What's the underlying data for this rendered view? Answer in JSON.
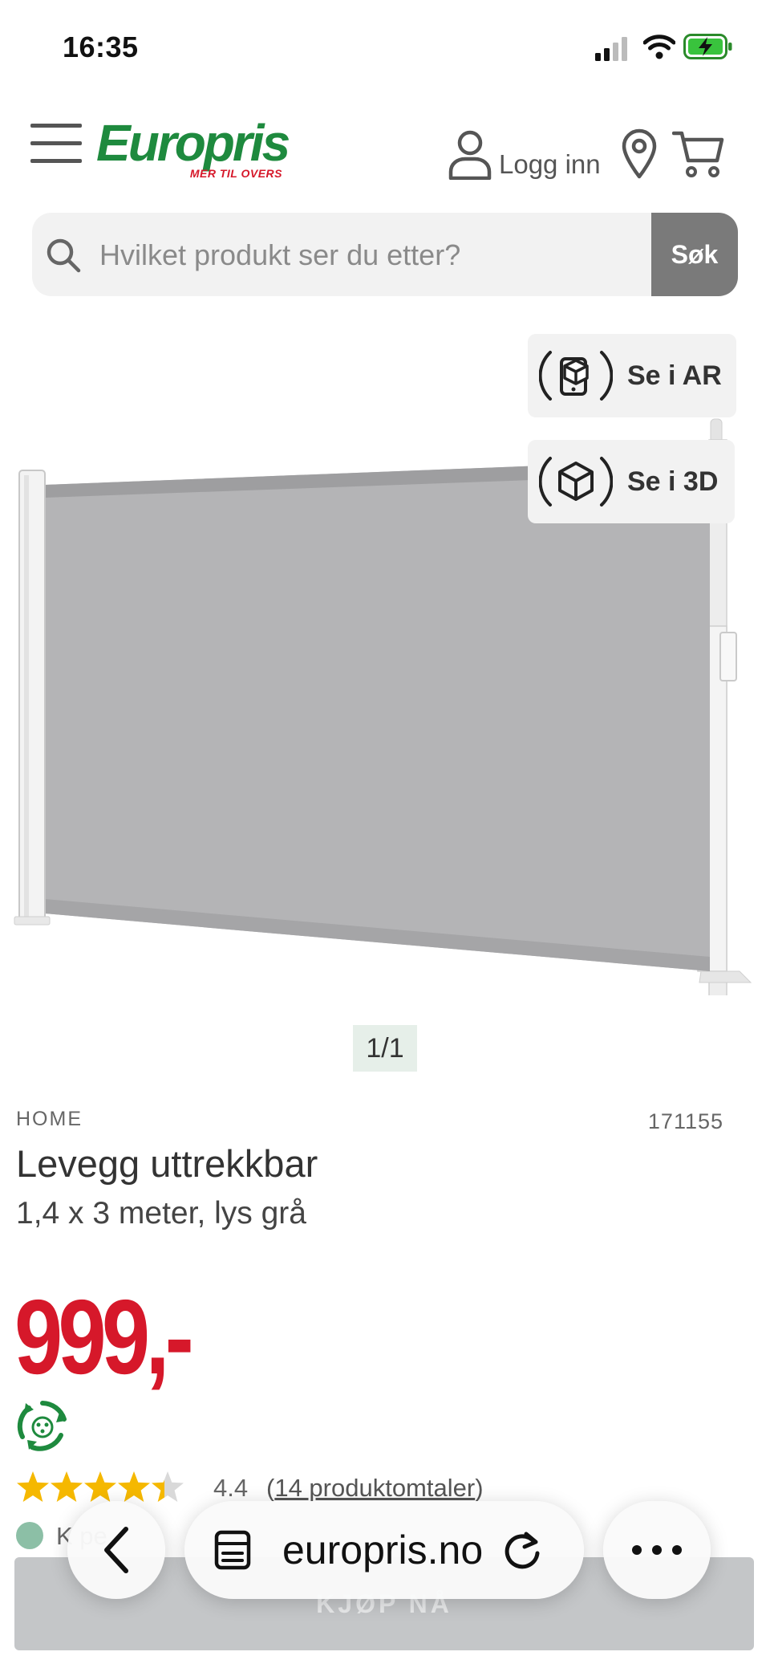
{
  "status_bar": {
    "time": "16:35"
  },
  "header": {
    "logo_text": "Europris",
    "logo_tagline": "MER TIL OVERS",
    "login_label": "Logg inn"
  },
  "search": {
    "placeholder": "Hvilket produkt ser du etter?",
    "button_label": "Søk"
  },
  "gallery": {
    "ar_label": "Se i AR",
    "view_3d_label": "Se i 3D",
    "pager": "1/1"
  },
  "product": {
    "brand": "HOME",
    "sku": "171155",
    "title": "Levegg uttrekkbar",
    "subtitle": "1,4 x 3 meter, lys grå",
    "price": "999,-",
    "rating": 4.4,
    "rating_text": "4.4",
    "reviews_link": "14 produktomtaler",
    "stock_text": "K         pe",
    "buy_label": "KJØP NÅ"
  },
  "browser": {
    "url": "europris.no"
  },
  "colors": {
    "brand_green": "#1e8a3e",
    "price_red": "#d6182a",
    "star_yellow": "#f5b800",
    "search_button": "#7a7a7a",
    "buy_button": "#c4c6c8"
  }
}
